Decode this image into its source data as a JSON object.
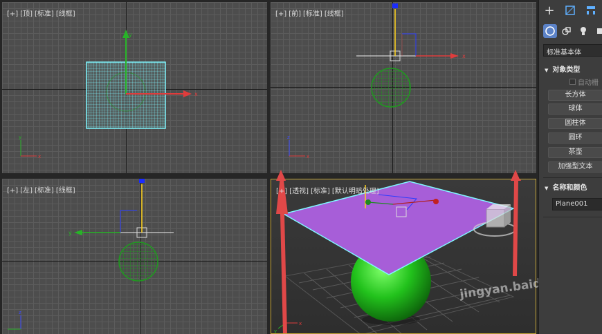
{
  "viewports": {
    "top": {
      "labels": [
        "[+]",
        "[顶]",
        "[标准]",
        "[线框]"
      ]
    },
    "front": {
      "labels": [
        "[+]",
        "[前]",
        "[标准]",
        "[线框]"
      ]
    },
    "left": {
      "labels": [
        "[+]",
        "[左]",
        "[标准]",
        "[线框]"
      ]
    },
    "persp": {
      "labels": [
        "[+]",
        "[透视]",
        "[标准]",
        "[默认明暗处理]"
      ]
    }
  },
  "axis_letters": {
    "x": "x",
    "y": "y",
    "z": "z"
  },
  "command_panel": {
    "dropdown": "标准基本体",
    "object_type_title": "对象类型",
    "autogrid_label": "自动栅",
    "buttons": [
      "长方体",
      "球体",
      "圆柱体",
      "圆环",
      "茶壶",
      "加强型文本"
    ],
    "name_color_title": "名称和颜色",
    "object_name": "Plane001"
  },
  "colors": {
    "selection": "#7ff6ff",
    "sphere_wire": "#1f9a1f",
    "plane_fill": "#a75ed8",
    "arrow": "#e03c3c"
  },
  "watermark": "jingyan.baidu"
}
